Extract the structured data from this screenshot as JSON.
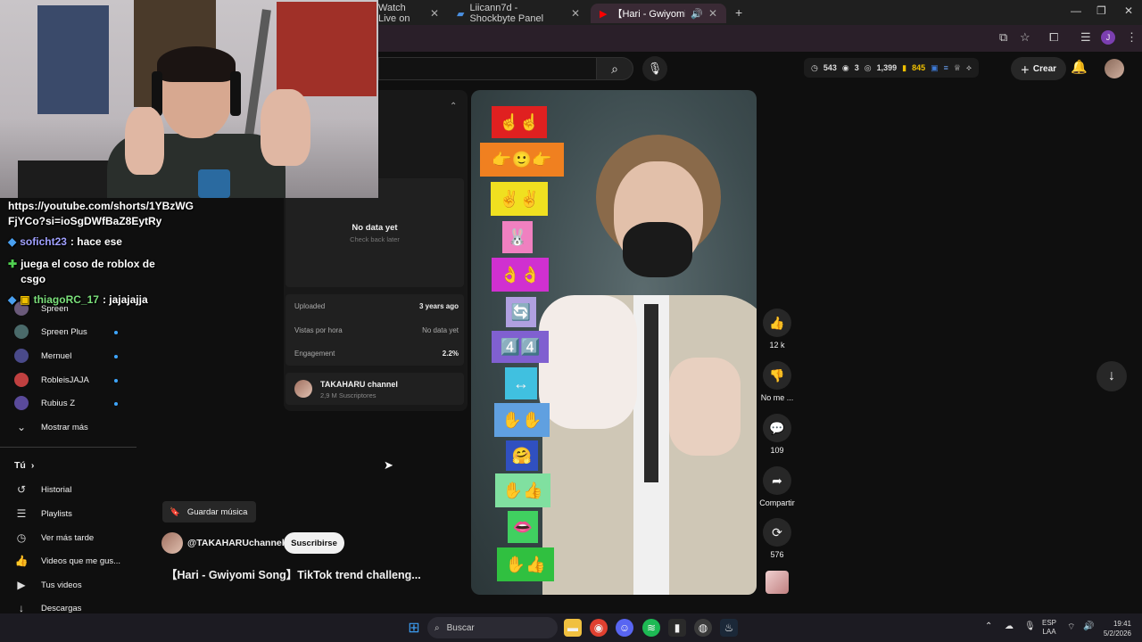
{
  "browser": {
    "tabs": [
      {
        "label": "Watch Live on",
        "active": false
      },
      {
        "label": "Liicann7d - Shockbyte Panel",
        "active": false
      },
      {
        "label": "【Hari - Gwiyomi Song】TikT",
        "active": true
      }
    ],
    "new_tab": "+",
    "profile_initial": "J"
  },
  "youtube": {
    "stats": {
      "views_icon_val": "543",
      "live": "3",
      "watching": "1,399",
      "points": "845"
    },
    "create_label": "Crear"
  },
  "chat": {
    "messages": [
      {
        "user": "",
        "text": "https://youtube.com/shorts/1YBzWGFjYCo?si=ioSgDWfBaZ8EytRy"
      },
      {
        "user": "soficht23",
        "text": ": hace ese"
      },
      {
        "user": "",
        "text": "juega el coso de roblox de csgo"
      },
      {
        "user": "thiagoRC_17",
        "text": ": jajajajja"
      }
    ]
  },
  "sidebar": {
    "subscriptions": [
      {
        "label": "Spreen",
        "avatar_color": "#6a5a7a"
      },
      {
        "label": "Spreen Plus",
        "avatar_color": "#4a6a6a"
      },
      {
        "label": "Mernuel",
        "avatar_color": "#4a4a8a"
      },
      {
        "label": "RobleisJAJA",
        "avatar_color": "#c04040"
      },
      {
        "label": "Rubius Z",
        "avatar_color": "#5a4a9a"
      }
    ],
    "show_more": "Mostrar más",
    "you_header": "Tú",
    "you_items": [
      {
        "label": "Historial",
        "icon": "history-icon"
      },
      {
        "label": "Playlists",
        "icon": "playlists-icon"
      },
      {
        "label": "Ver más tarde",
        "icon": "clock-icon"
      },
      {
        "label": "Videos que me gus...",
        "icon": "thumbs-up-icon"
      },
      {
        "label": "Tus videos",
        "icon": "play-box-icon"
      },
      {
        "label": "Descargas",
        "icon": "download-icon"
      }
    ]
  },
  "panel": {
    "no_data": "No data yet",
    "check_back": "Check back later",
    "rows": [
      {
        "label": "Uploaded",
        "value": "3 years ago"
      },
      {
        "label": "Vistas por hora",
        "value": "No data yet"
      },
      {
        "label": "Engagement",
        "value": "2.2%"
      }
    ],
    "channel_name": "TAKAHARU channel",
    "channel_subs": "2,9 M Suscriptores"
  },
  "video": {
    "emoji_stack": [
      "☝☝",
      "👉🙂👉",
      "✌✌",
      "🐰",
      "👌👌",
      "🔄",
      "4️⃣4️⃣",
      "↔",
      "✋✋",
      "🤗",
      "✋👍",
      "👄",
      "✋👍"
    ]
  },
  "actions": [
    {
      "name": "like",
      "icon": "👍",
      "label": "12 k"
    },
    {
      "name": "dislike",
      "icon": "👎",
      "label": "No me ..."
    },
    {
      "name": "comments",
      "icon": "💬",
      "label": "109"
    },
    {
      "name": "share",
      "icon": "➦",
      "label": "Compartir"
    },
    {
      "name": "remix",
      "icon": "⟳",
      "label": "576"
    }
  ],
  "meta": {
    "save_music": "Guardar música",
    "channel_handle": "@TAKAHARUchannel",
    "subscribe": "Suscribirse",
    "title": "【Hari - Gwiyomi Song】TikTok trend challeng..."
  },
  "taskbar": {
    "search": "Buscar",
    "lang_top": "ESP",
    "lang_bottom": "LAA",
    "time": "19:41",
    "date": "5/2/2026"
  }
}
